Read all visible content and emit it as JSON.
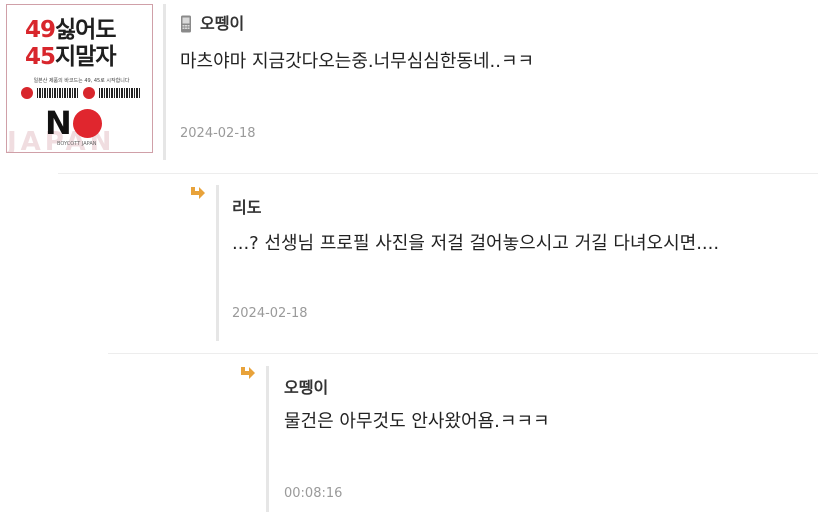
{
  "avatar": {
    "line1_num": "49",
    "line1_word": "싫어도",
    "line2_num": "45",
    "line2_word": "지말자",
    "subtitle": "일본산 제품의 바코드는 49, 45로 시작합니다",
    "no_n": "N",
    "footer": "BOYCOTT JAPAN",
    "background_word": "JAPAN"
  },
  "comments": [
    {
      "author": "오뗑이",
      "author_icon": "phone-icon",
      "message": "마츠야마 지금갓다오는중.너무심심한동네..ㅋㅋ",
      "date": "2024-02-18"
    },
    {
      "author": "리도",
      "reply_icon": "reply-arrow-icon",
      "message": "...? 선생님 프로필 사진을 저걸 걸어놓으시고 거길 다녀오시면....",
      "date": "2024-02-18"
    },
    {
      "author": "오뗑이",
      "reply_icon": "reply-arrow-icon",
      "message": "물건은 아무것도 안사왔어욤.ㅋㅋㅋ",
      "date": "00:08:16"
    }
  ],
  "colors": {
    "accent_red": "#d8262c",
    "reply_icon": "#e8a23a",
    "date_text": "#9a9a9a",
    "divider": "#e6e6e6"
  }
}
